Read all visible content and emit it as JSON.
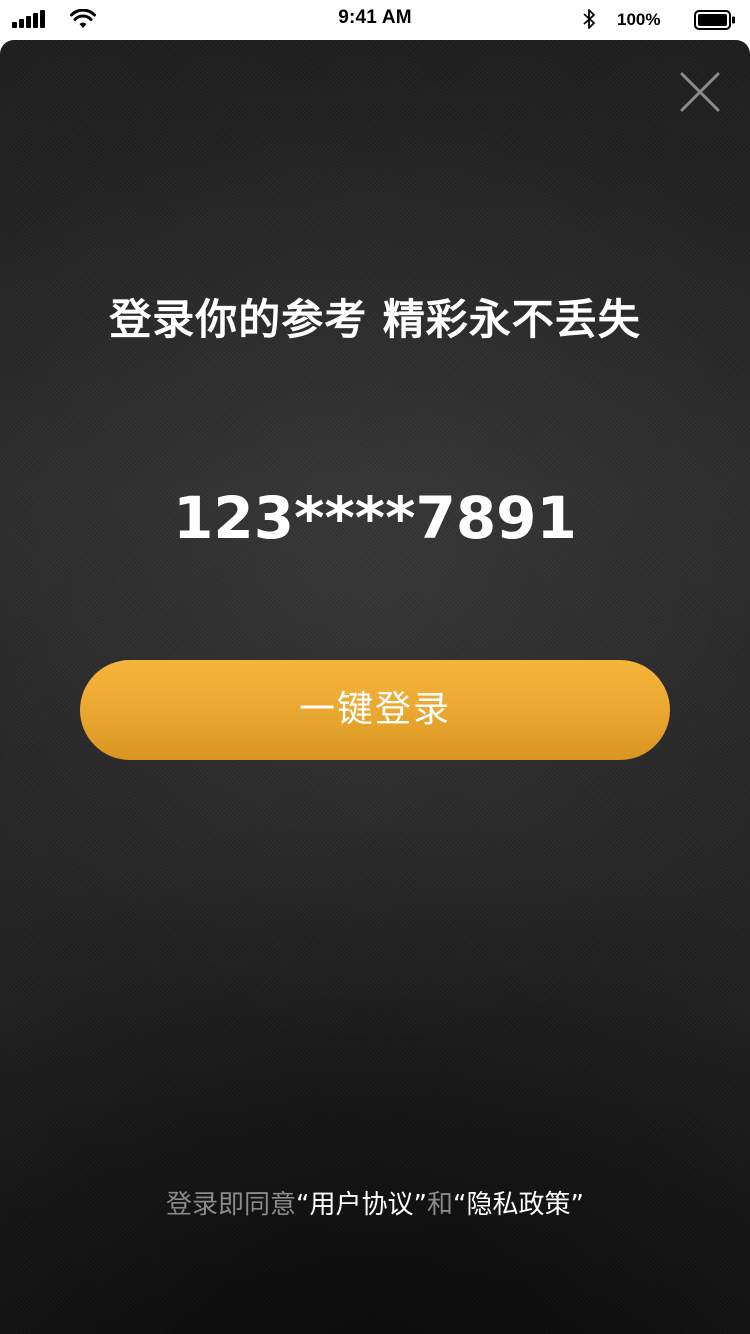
{
  "status_bar": {
    "time": "9:41 AM",
    "battery_percent": "100%",
    "icons": [
      "signal-icon",
      "wifi-icon",
      "bluetooth-icon",
      "battery-icon"
    ]
  },
  "login": {
    "headline": "登录你的参考 精彩永不丢失",
    "phone_number": "123****7891",
    "button_label": "一键登录",
    "close_icon": "close-icon"
  },
  "agreement": {
    "prefix": "登录即同意",
    "user_agreement": "“用户协议”",
    "conjunction": "和",
    "privacy_policy": "“隐私政策”"
  },
  "colors": {
    "accent_start": "#f7b43a",
    "accent_end": "#d9951f",
    "background": "#262626",
    "muted_text": "#8a8a8a"
  }
}
